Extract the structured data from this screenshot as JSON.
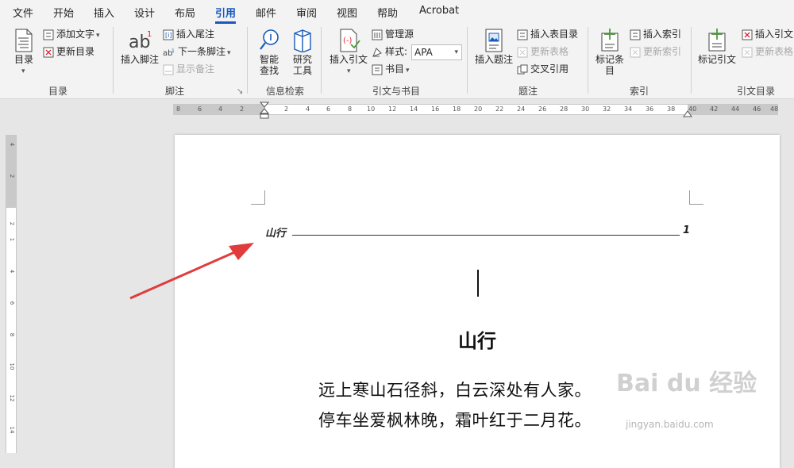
{
  "menu": {
    "tabs": [
      "文件",
      "开始",
      "插入",
      "设计",
      "布局",
      "引用",
      "邮件",
      "审阅",
      "视图",
      "帮助",
      "Acrobat"
    ],
    "active": "引用"
  },
  "ribbon": {
    "toc": {
      "big_label": "目录",
      "add_text": "添加文字",
      "update_toc": "更新目录",
      "group": "目录"
    },
    "footnotes": {
      "insert_footnote": "插入脚注",
      "insert_endnote": "插入尾注",
      "next_footnote": "下一条脚注",
      "show_notes": "显示备注",
      "group": "脚注"
    },
    "research": {
      "smart_lookup": "智能查找",
      "researcher": "研究工具",
      "group": "信息检索"
    },
    "citations": {
      "insert_citation": "插入引文",
      "manage_sources": "管理源",
      "style_label": "样式:",
      "style_value": "APA",
      "bibliography": "书目",
      "group": "引文与书目"
    },
    "captions": {
      "insert_caption": "插入题注",
      "insert_table_of_figures": "插入表目录",
      "update_table": "更新表格",
      "cross_reference": "交叉引用",
      "group": "题注"
    },
    "index": {
      "mark_entry": "标记条目",
      "insert_index": "插入索引",
      "update_index": "更新索引",
      "group": "索引"
    },
    "authorities": {
      "mark_citation": "标记引文",
      "insert_table": "插入引文目",
      "update_table": "更新表格",
      "group": "引文目录"
    }
  },
  "ruler": {
    "tab_selector": "L",
    "horizontal": [
      "8",
      "6",
      "4",
      "2",
      "2",
      "4",
      "6",
      "8",
      "10",
      "12",
      "14",
      "16",
      "18",
      "20",
      "22",
      "24",
      "26",
      "28",
      "30",
      "32",
      "34",
      "36",
      "38",
      "40",
      "42",
      "44",
      "46",
      "48"
    ],
    "vertical": [
      "4",
      "2",
      "2",
      "1",
      "4",
      "6",
      "8",
      "10",
      "12",
      "14"
    ]
  },
  "document": {
    "header_left": "山行",
    "header_right": "1",
    "title": "山行",
    "lines": [
      "远上寒山石径斜，白云深处有人家。",
      "停车坐爱枫林晚，霜叶红于二月花。"
    ]
  },
  "watermark": {
    "brand": "Bai du 经验",
    "url": "jingyan.baidu.com"
  },
  "colors": {
    "accent": "#185abd",
    "arrow": "#e03c3c"
  }
}
